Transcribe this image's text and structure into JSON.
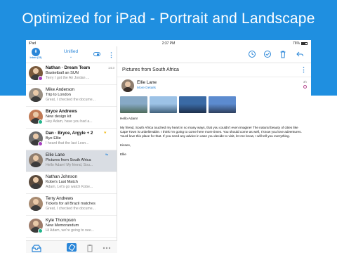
{
  "headline": "Optimized for iPad - Portrait and Landscape",
  "status": {
    "carrier": "iPad",
    "time": "2:37 PM",
    "battery": "76%"
  },
  "left_toolbar": {
    "inbox_label": "Inbox (15)",
    "folder_title": "Unified"
  },
  "messages": [
    {
      "sender": "Nathan · Dream Team",
      "subject": "Basketball an SUN",
      "preview": "Terry I got the Air Jordan ...",
      "time": "14:3",
      "bold": true,
      "selected": false,
      "avatar": "#7a5a3c",
      "badge": "#a53fbf"
    },
    {
      "sender": "Mike Anderson",
      "subject": "Trip to London",
      "preview": "Great, I checked the docume...",
      "time": "",
      "bold": false,
      "selected": false,
      "avatar": "#9a8f83",
      "badge": ""
    },
    {
      "sender": "Bryce Andrews",
      "subject": "New design kit",
      "preview": "Hey Adam, have you had a...",
      "time": "",
      "bold": true,
      "selected": false,
      "avatar": "#c07a55",
      "badge": "#20b38a"
    },
    {
      "sender": "Dan · Bryce, Argyle + 2",
      "subject": "Bye Ellie",
      "preview": "I heard that the last Lesn...",
      "time": "",
      "bold": true,
      "selected": false,
      "avatar": "#6d6d6d",
      "badge": "#a53fbf",
      "flag": true
    },
    {
      "sender": "Ellie Lane",
      "subject": "Pictures from South Africa",
      "preview": "Hello Adam! My friend, Sou...",
      "time": "",
      "bold": false,
      "selected": true,
      "avatar": "#8e7d6e",
      "badge": "",
      "fwd": true
    },
    {
      "sender": "Nathan Johnson",
      "subject": "Kobe's Last Match",
      "preview": "Adam, Let's go watch Kobe...",
      "time": "",
      "bold": false,
      "selected": false,
      "avatar": "#5a4a3c",
      "badge": ""
    },
    {
      "sender": "Terry Andrews",
      "subject": "Tickets for all Brazil matches",
      "preview": "Great, I checked the docume...",
      "time": "",
      "bold": false,
      "selected": false,
      "avatar": "#a88b72",
      "badge": ""
    },
    {
      "sender": "Kyle Thompson",
      "subject": "New Memorandum",
      "preview": "Hi Adam, we're going to nee...",
      "time": "",
      "bold": false,
      "selected": false,
      "avatar": "#9e7c6a",
      "badge": "#20b38a"
    }
  ],
  "icons": {
    "inbox": "inbox-icon",
    "toggle": "toggle-icon",
    "more_left": "more-vertical-icon",
    "snooze": "clock-icon",
    "done": "check-circle-icon",
    "trash": "trash-icon",
    "reply": "reply-icon",
    "more_right": "more-vertical-icon",
    "tabs": [
      "mail-tab-icon",
      "compose-icon",
      "clipboard-icon",
      "more-horizontal-icon"
    ]
  },
  "reader": {
    "subject": "Pictures from South Africa",
    "sender": "Ellie Lane",
    "more_details": "More Details",
    "time": "3h",
    "greeting": "Hello Adam!",
    "body": "My friend, South Africa touched my heart in so many ways, that you couldn't even imagine! The natural beauty of cities like Cape Town is unbelievable. I think I'm going to come here more times. You should come as well, I know you love adventures. You'd love this place for that. If you need any advice in case you decide to visit, let me know, I will tell you everything.",
    "signoff": "Kisses,",
    "signature": "Ellie",
    "attachments": [
      {
        "name": "photo-mountain-lake",
        "colors": [
          "#87a9c6",
          "#4d6b5a"
        ]
      },
      {
        "name": "photo-coast",
        "colors": [
          "#9cc2e6",
          "#3f5f7a"
        ]
      },
      {
        "name": "photo-city-dusk",
        "colors": [
          "#3a6aa5",
          "#1d2f4a"
        ]
      },
      {
        "name": "photo-sunset-bay",
        "colors": [
          "#5c8bcf",
          "#2c3e5c"
        ]
      }
    ]
  },
  "colors": {
    "accent": "#2a86d8",
    "band": "#1f8fe0"
  }
}
